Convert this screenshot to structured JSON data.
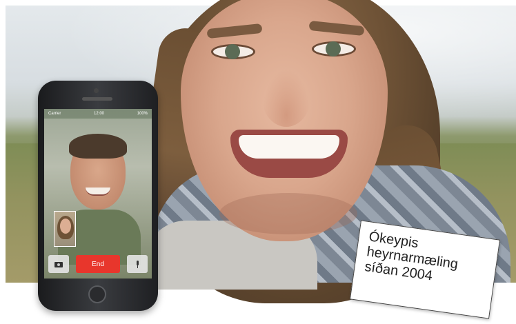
{
  "phone": {
    "status_carrier": "Carrier",
    "status_time": "12:00",
    "status_battery": "100%",
    "end_label": "End",
    "camera_icon": "camera-icon",
    "mic_icon": "mic-icon"
  },
  "card": {
    "line1": "Ókeypis",
    "line2": "heyrnarmæling",
    "line3": "síðan 2004"
  },
  "colors": {
    "end_button": "#e8362c",
    "card_border": "#444444"
  }
}
